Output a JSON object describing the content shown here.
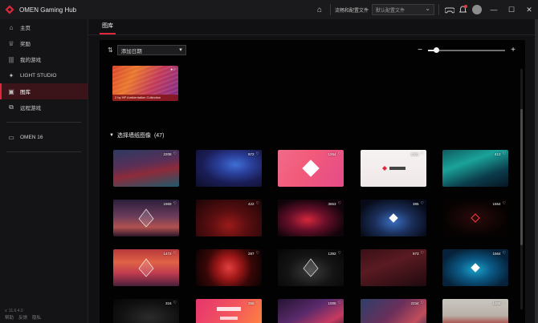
{
  "app": {
    "title": "OMEN Gaming Hub",
    "brand_color": "#e0283c"
  },
  "titlebar": {
    "settings_text": "流畅和配置文件",
    "profile_select_placeholder": "默认配置文件",
    "icons": [
      "home-icon",
      "controller-icon",
      "bell-icon",
      "avatar-icon",
      "minimize-icon",
      "maximize-icon",
      "close-icon"
    ]
  },
  "sidebar": {
    "items": [
      {
        "label": "主页",
        "icon": "home-icon",
        "active": false
      },
      {
        "label": "奖励",
        "icon": "trophy-icon",
        "active": false
      },
      {
        "label": "我的游戏",
        "icon": "library-icon",
        "active": false
      },
      {
        "label": "LIGHT STUDIO",
        "icon": "light-studio-icon",
        "active": false
      },
      {
        "label": "图库",
        "icon": "gallery-icon",
        "active": true
      },
      {
        "label": "远程游戏",
        "icon": "remote-play-icon",
        "active": false
      }
    ],
    "device": {
      "label": "OMEN 16",
      "icon": "laptop-icon"
    },
    "version": "v. 11.6.4.0",
    "footer": [
      "帮助",
      "反馈",
      "隐私"
    ]
  },
  "main": {
    "tab": "图库",
    "sort": {
      "selected": "添加日期"
    },
    "zoom": {
      "level": 0.1
    },
    "featured": {
      "caption": "2 by HP Ambientation Collection"
    },
    "section": {
      "title": "选择墙纸图像",
      "count": "(47)"
    },
    "wallpapers": [
      {
        "count": "2208",
        "style": "linear-gradient(170deg,#2d3a63 0%,#5a2f56 40%,#8d2b3b 60%,#1d5a6b 100%)"
      },
      {
        "count": "972",
        "style": "radial-gradient(ellipse at 60% 40%,#3f6fd4 0%,#2a3f9a 30%,#1a1d55 60%,#0d0f2a 100%)"
      },
      {
        "count": "1264",
        "style": "linear-gradient(120deg,#f06b8b 0%,#f25b7a 40%,#e54b89 100%)",
        "diamond": true
      },
      {
        "count": "1001",
        "style": "linear-gradient(180deg,#f7f2f2 0%,#efe8e8 100%)",
        "omen": true
      },
      {
        "count": "412",
        "style": "linear-gradient(160deg,#0e5b5e 0%,#1aa39a 35%,#0b3b4a 70%,#061522 100%)"
      },
      {
        "count": "1969",
        "style": "linear-gradient(180deg,#2b1f3b 0%,#6a3b5a 45%,#b0524f 75%,#2c1628 100%)",
        "tri": true
      },
      {
        "count": "422",
        "style": "radial-gradient(ellipse at 50% 70%,#9b1a1a 0%,#5a0e10 40%,#1a0506 100%)"
      },
      {
        "count": "3653",
        "style": "radial-gradient(ellipse at 45% 55%,#d4273a 0%,#6a0f2a 35%,#12040b 75%)"
      },
      {
        "count": "385",
        "style": "radial-gradient(ellipse at 50% 60%,#3a6ec0 0%,#1b2f5a 40%,#070b19 80%)",
        "diamond": true
      },
      {
        "count": "1564",
        "style": "radial-gradient(ellipse at 50% 50%,#2a0a0a 0%,#060202 70%)",
        "diamondRed": true
      },
      {
        "count": "1472",
        "style": "linear-gradient(180deg,#b6383b 0%,#e06245 35%,#c03b4f 65%,#4a1f3a 100%)",
        "tri": true
      },
      {
        "count": "287",
        "style": "radial-gradient(circle at 50% 50%,#e04040 0%,#a01818 30%,#3a0707 60%,#0a0202 100%)"
      },
      {
        "count": "1392",
        "style": "radial-gradient(ellipse at 50% 60%,#3a3a3a 0%,#141414 50%,#050505 100%)",
        "tri": true
      },
      {
        "count": "973",
        "style": "linear-gradient(160deg,#3a0f16 0%,#5a1a22 40%,#1f0a0e 100%)"
      },
      {
        "count": "1564",
        "style": "radial-gradient(ellipse at 50% 55%,#1aa2c9 0%,#0b5a86 35%,#06223a 75%)",
        "diamond": true
      },
      {
        "count": "316",
        "style": "radial-gradient(ellipse at 55% 50%,#2b2b2b 0%,#101010 60%,#050505 100%)"
      },
      {
        "count": "356",
        "style": "linear-gradient(120deg,#e6346e 0%,#f2555e 50%,#ff8a3a 100%)",
        "omen2021": true
      },
      {
        "count": "1005",
        "style": "linear-gradient(150deg,#241431 0%,#5a2a6b 40%,#c53a61 70%,#1a0f22 100%)"
      },
      {
        "count": "2234",
        "style": "linear-gradient(135deg,#2c3f6a 0%,#6b2f5a 45%,#c04d5b 75%,#1c2b4d 100%)"
      },
      {
        "count": "1358",
        "style": "linear-gradient(180deg,#c9c6c0 0%,#b9b1a8 45%,#a32a2a 75%,#3a2120 100%)"
      }
    ]
  }
}
